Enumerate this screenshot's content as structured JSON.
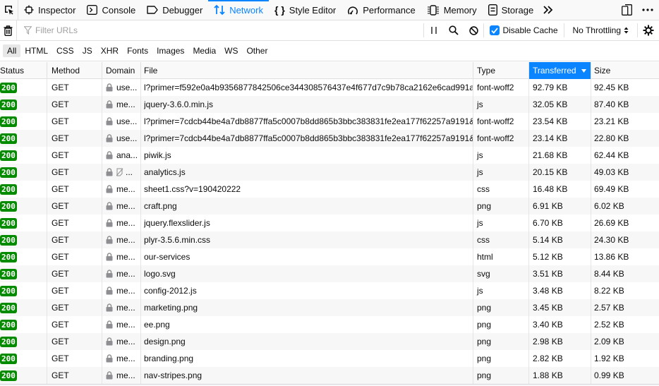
{
  "devtools": {
    "tabs": [
      {
        "label": "Inspector",
        "icon": "inspector-icon",
        "active": false
      },
      {
        "label": "Console",
        "icon": "console-icon",
        "active": false
      },
      {
        "label": "Debugger",
        "icon": "debugger-icon",
        "active": false
      },
      {
        "label": "Network",
        "icon": "network-icon",
        "active": true
      },
      {
        "label": "Style Editor",
        "icon": "style-editor-icon",
        "active": false
      },
      {
        "label": "Performance",
        "icon": "performance-icon",
        "active": false
      },
      {
        "label": "Memory",
        "icon": "memory-icon",
        "active": false
      },
      {
        "label": "Storage",
        "icon": "storage-icon",
        "active": false
      }
    ],
    "more_tabs": "»",
    "accent_color": "#0a84ff"
  },
  "toolbar": {
    "filter_placeholder": "Filter URLs",
    "filter_value": "",
    "disable_cache_label": "Disable Cache",
    "disable_cache_checked": true,
    "throttling_label": "No Throttling"
  },
  "type_filters": [
    "All",
    "HTML",
    "CSS",
    "JS",
    "XHR",
    "Fonts",
    "Images",
    "Media",
    "WS",
    "Other"
  ],
  "active_type_filter": "All",
  "table": {
    "columns": [
      "Status",
      "Method",
      "Domain",
      "File",
      "Type",
      "Transferred",
      "Size"
    ],
    "sorted_column": "Transferred",
    "sort_direction": "descending",
    "status_color": "#058b00",
    "rows": [
      {
        "status": "200",
        "method": "GET",
        "domain": "use...",
        "file": "l?primer=f592e0a4b9356877842506ce344308576437e4f677d7c9b78ca2162e6cad991a",
        "type": "font-woff2",
        "transferred": "92.79 KB",
        "size": "92.45 KB"
      },
      {
        "status": "200",
        "method": "GET",
        "domain": "me...",
        "file": "jquery-3.6.0.min.js",
        "type": "js",
        "transferred": "32.05 KB",
        "size": "87.40 KB"
      },
      {
        "status": "200",
        "method": "GET",
        "domain": "use...",
        "file": "l?primer=7cdcb44be4a7db8877ffa5c0007b8dd865b3bbc383831fe2ea177f62257a9191&",
        "type": "font-woff2",
        "transferred": "23.54 KB",
        "size": "23.21 KB"
      },
      {
        "status": "200",
        "method": "GET",
        "domain": "use...",
        "file": "l?primer=7cdcb44be4a7db8877ffa5c0007b8dd865b3bbc383831fe2ea177f62257a9191&",
        "type": "font-woff2",
        "transferred": "23.14 KB",
        "size": "22.80 KB"
      },
      {
        "status": "200",
        "method": "GET",
        "domain": "ana...",
        "file": "piwik.js",
        "type": "js",
        "transferred": "21.68 KB",
        "size": "62.44 KB"
      },
      {
        "status": "200",
        "method": "GET",
        "domain": "...",
        "file": "analytics.js",
        "type": "js",
        "transferred": "20.15 KB",
        "size": "49.03 KB",
        "tracker": true
      },
      {
        "status": "200",
        "method": "GET",
        "domain": "me...",
        "file": "sheet1.css?v=190420222",
        "type": "css",
        "transferred": "16.48 KB",
        "size": "69.49 KB"
      },
      {
        "status": "200",
        "method": "GET",
        "domain": "me...",
        "file": "craft.png",
        "type": "png",
        "transferred": "6.91 KB",
        "size": "6.02 KB"
      },
      {
        "status": "200",
        "method": "GET",
        "domain": "me...",
        "file": "jquery.flexslider.js",
        "type": "js",
        "transferred": "6.70 KB",
        "size": "26.69 KB"
      },
      {
        "status": "200",
        "method": "GET",
        "domain": "me...",
        "file": "plyr-3.5.6.min.css",
        "type": "css",
        "transferred": "5.14 KB",
        "size": "24.30 KB"
      },
      {
        "status": "200",
        "method": "GET",
        "domain": "me...",
        "file": "our-services",
        "type": "html",
        "transferred": "5.12 KB",
        "size": "13.86 KB"
      },
      {
        "status": "200",
        "method": "GET",
        "domain": "me...",
        "file": "logo.svg",
        "type": "svg",
        "transferred": "3.51 KB",
        "size": "8.44 KB"
      },
      {
        "status": "200",
        "method": "GET",
        "domain": "me...",
        "file": "config-2012.js",
        "type": "js",
        "transferred": "3.48 KB",
        "size": "8.22 KB"
      },
      {
        "status": "200",
        "method": "GET",
        "domain": "me...",
        "file": "marketing.png",
        "type": "png",
        "transferred": "3.45 KB",
        "size": "2.57 KB"
      },
      {
        "status": "200",
        "method": "GET",
        "domain": "me...",
        "file": "ee.png",
        "type": "png",
        "transferred": "3.40 KB",
        "size": "2.52 KB"
      },
      {
        "status": "200",
        "method": "GET",
        "domain": "me...",
        "file": "design.png",
        "type": "png",
        "transferred": "2.98 KB",
        "size": "2.09 KB"
      },
      {
        "status": "200",
        "method": "GET",
        "domain": "me...",
        "file": "branding.png",
        "type": "png",
        "transferred": "2.82 KB",
        "size": "1.92 KB"
      },
      {
        "status": "200",
        "method": "GET",
        "domain": "me...",
        "file": "nav-stripes.png",
        "type": "png",
        "transferred": "1.88 KB",
        "size": "0.99 KB"
      }
    ]
  }
}
